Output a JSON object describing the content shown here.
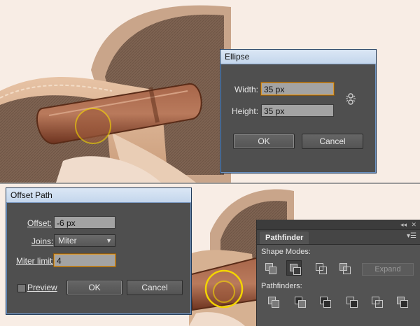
{
  "ellipse_dialog": {
    "title": "Ellipse",
    "width_label": "Width:",
    "width_value": "35 px",
    "height_label": "Height:",
    "height_value": "35 px",
    "ok_label": "OK",
    "cancel_label": "Cancel",
    "link_icon": "constrain-proportions-icon"
  },
  "offset_dialog": {
    "title": "Offset Path",
    "offset_label": "Offset:",
    "offset_value": "-6 px",
    "joins_label": "Joins:",
    "joins_value": "Miter",
    "miter_label": "Miter limit:",
    "miter_value": "4",
    "preview_label": "Preview",
    "preview_checked": false,
    "ok_label": "OK",
    "cancel_label": "Cancel"
  },
  "pathfinder": {
    "tab_label": "Pathfinder",
    "shape_modes_label": "Shape Modes:",
    "expand_label": "Expand",
    "pathfinders_label": "Pathfinders:",
    "topbar_icons": [
      "collapse-icon",
      "close-icon"
    ],
    "shape_mode_icons": [
      "unite-icon",
      "minus-front-icon",
      "intersect-icon",
      "exclude-icon"
    ],
    "pathfinder_icons": [
      "divide-icon",
      "trim-icon",
      "merge-icon",
      "crop-icon",
      "outline-icon",
      "minus-back-icon"
    ]
  },
  "colors": {
    "dialog_bg": "#4f4f4f",
    "title_bar": "#c8d9ee",
    "focus_border": "#d9962c",
    "highlight_circle": "#f3d400",
    "belt": "#8b4a2c"
  }
}
